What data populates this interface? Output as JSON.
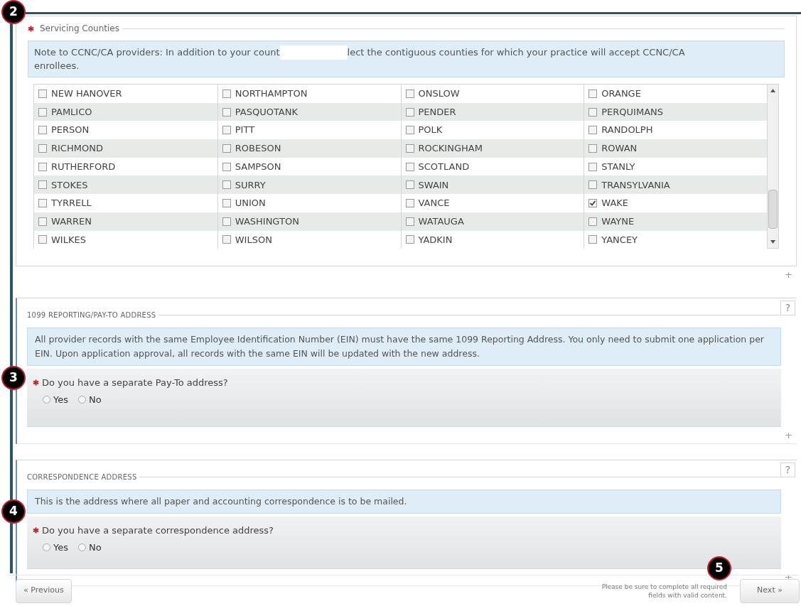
{
  "sections": [
    {
      "kind": "counties",
      "legend": "Servicing Counties",
      "required": true,
      "note": {
        "before": "Note to CCNC/CA providers: In addition to your count",
        "after": "lect the contiguous counties for which your practice will accept CCNC/CA",
        "line2": "enrollees."
      },
      "counties": [
        {
          "label": "NEW HANOVER",
          "checked": false
        },
        {
          "label": "NORTHAMPTON",
          "checked": false
        },
        {
          "label": "ONSLOW",
          "checked": false
        },
        {
          "label": "ORANGE",
          "checked": false
        },
        {
          "label": "PAMLICO",
          "checked": false
        },
        {
          "label": "PASQUOTANK",
          "checked": false
        },
        {
          "label": "PENDER",
          "checked": false
        },
        {
          "label": "PERQUIMANS",
          "checked": false
        },
        {
          "label": "PERSON",
          "checked": false
        },
        {
          "label": "PITT",
          "checked": false
        },
        {
          "label": "POLK",
          "checked": false
        },
        {
          "label": "RANDOLPH",
          "checked": false
        },
        {
          "label": "RICHMOND",
          "checked": false
        },
        {
          "label": "ROBESON",
          "checked": false
        },
        {
          "label": "ROCKINGHAM",
          "checked": false
        },
        {
          "label": "ROWAN",
          "checked": false
        },
        {
          "label": "RUTHERFORD",
          "checked": false
        },
        {
          "label": "SAMPSON",
          "checked": false
        },
        {
          "label": "SCOTLAND",
          "checked": false
        },
        {
          "label": "STANLY",
          "checked": false
        },
        {
          "label": "STOKES",
          "checked": false
        },
        {
          "label": "SURRY",
          "checked": false
        },
        {
          "label": "SWAIN",
          "checked": false
        },
        {
          "label": "TRANSYLVANIA",
          "checked": false
        },
        {
          "label": "TYRRELL",
          "checked": false
        },
        {
          "label": "UNION",
          "checked": false
        },
        {
          "label": "VANCE",
          "checked": false
        },
        {
          "label": "WAKE",
          "checked": true
        },
        {
          "label": "WARREN",
          "checked": false
        },
        {
          "label": "WASHINGTON",
          "checked": false
        },
        {
          "label": "WATAUGA",
          "checked": false
        },
        {
          "label": "WAYNE",
          "checked": false
        },
        {
          "label": "WILKES",
          "checked": false
        },
        {
          "label": "WILSON",
          "checked": false
        },
        {
          "label": "YADKIN",
          "checked": false
        },
        {
          "label": "YANCEY",
          "checked": false
        }
      ],
      "expand": "+",
      "marker": "2"
    },
    {
      "kind": "question",
      "legend": "1099 REPORTING/PAY-TO ADDRESS",
      "help": "?",
      "note": "All provider records with the same Employee Identification Number (EIN) must have the same 1099 Reporting Address. You only need to submit one application per EIN. Upon application approval, all records with the same EIN will be updated with the new address.",
      "question": "Do you have a separate Pay-To address?",
      "required": true,
      "options": [
        {
          "label": "Yes",
          "selected": false
        },
        {
          "label": "No",
          "selected": false
        }
      ],
      "expand": "+",
      "marker": "3"
    },
    {
      "kind": "question",
      "legend": "CORRESPONDENCE ADDRESS",
      "help": "?",
      "note": "This is the address where all paper and accounting correspondence is to be mailed.",
      "question": "Do you have a separate correspondence address?",
      "required": true,
      "options": [
        {
          "label": "Yes",
          "selected": false
        },
        {
          "label": "No",
          "selected": false
        }
      ],
      "expand": "+",
      "marker": "4"
    }
  ],
  "footer": {
    "previous": "« Previous",
    "message": "Please be sure to complete all required fields with valid content.",
    "next": "Next »",
    "marker": "5"
  }
}
